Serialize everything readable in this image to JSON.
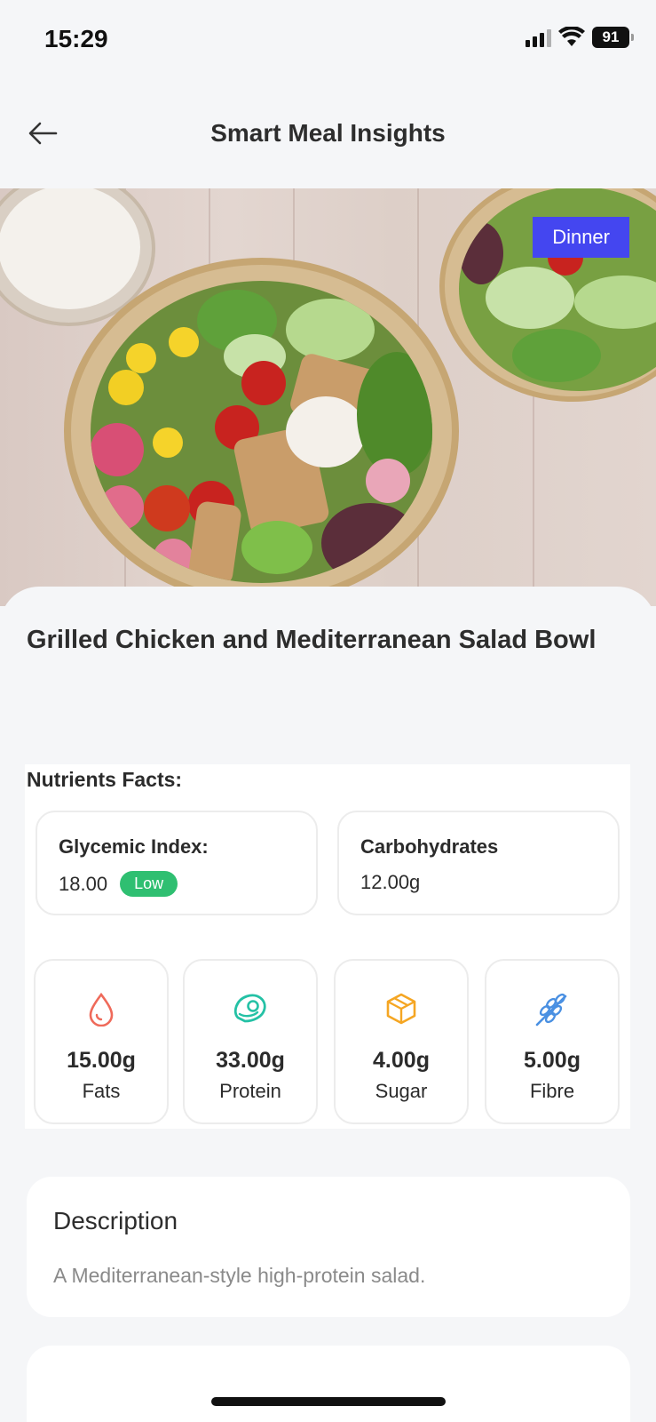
{
  "status_bar": {
    "time": "15:29",
    "battery": "91"
  },
  "header": {
    "title": "Smart Meal Insights",
    "back_icon": "arrow-left-icon"
  },
  "meal": {
    "type_badge": "Dinner",
    "name": "Grilled Chicken and Mediterranean Salad Bowl"
  },
  "nutrients": {
    "heading": "Nutrients Facts:",
    "glycemic": {
      "label": "Glycemic Index:",
      "value": "18.00",
      "level": "Low",
      "level_color": "#2fbf71"
    },
    "carbs": {
      "label": "Carbohydrates",
      "value": "12.00g"
    },
    "items": [
      {
        "amount": "15.00g",
        "name": "Fats",
        "icon": "fat-drop-icon",
        "color": "#ef6a5a"
      },
      {
        "amount": "33.00g",
        "name": "Protein",
        "icon": "meat-icon",
        "color": "#24c1a5"
      },
      {
        "amount": "4.00g",
        "name": "Sugar",
        "icon": "sugar-cube-icon",
        "color": "#f5a623"
      },
      {
        "amount": "5.00g",
        "name": "Fibre",
        "icon": "wheat-icon",
        "color": "#4a90e2"
      }
    ]
  },
  "description": {
    "title": "Description",
    "text": "A Mediterranean-style high-protein salad."
  },
  "colors": {
    "accent": "#4446f0",
    "background": "#f5f6f8"
  }
}
